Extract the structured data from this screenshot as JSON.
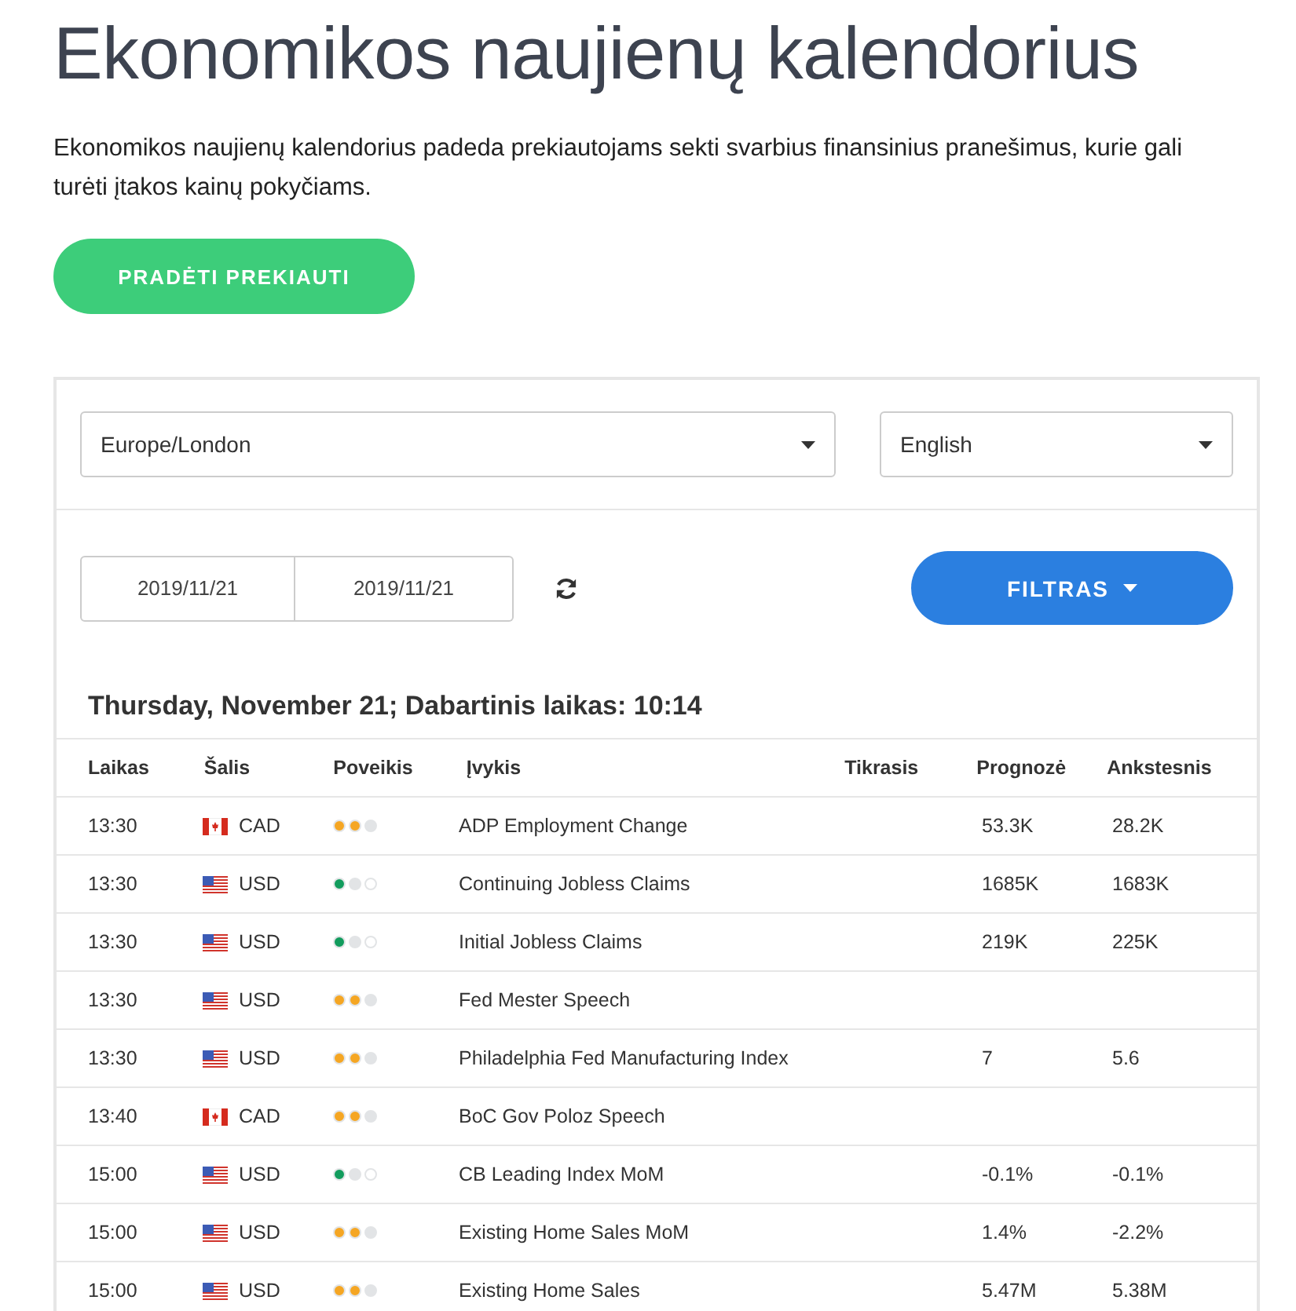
{
  "title": "Ekonomikos naujienų kalendorius",
  "intro": "Ekonomikos naujienų kalendorius padeda prekiautojams sekti svarbius finansinius pranešimus, kurie gali turėti įtakos kainų pokyčiams.",
  "cta": "PRADĖTI PREKIAUTI",
  "timezone": "Europe/London",
  "language": "English",
  "date_from": "2019/11/21",
  "date_to": "2019/11/21",
  "filter": "FILTRAS",
  "day_heading": "Thursday, November 21; Dabartinis laikas: 10:14",
  "columns": [
    "Laikas",
    "Šalis",
    "Poveikis",
    "Įvykis",
    "Tikrasis",
    "Prognozė",
    "Ankstesnis"
  ],
  "rows": [
    {
      "time": "13:30",
      "kind": "canada",
      "currency": "CAD",
      "level": 0.67,
      "event": "ADP Employment Change",
      "forecast": "53.3K",
      "previous": "28.2K"
    },
    {
      "time": "13:30",
      "kind": "usa",
      "currency": "USD",
      "level": 0.33,
      "event": "Continuing Jobless Claims",
      "forecast": "1685K",
      "previous": "1683K"
    },
    {
      "time": "13:30",
      "kind": "usa",
      "currency": "USD",
      "level": 0.33,
      "event": "Initial Jobless Claims",
      "forecast": "219K",
      "previous": "225K"
    },
    {
      "time": "13:30",
      "kind": "usa",
      "currency": "USD",
      "level": 0.67,
      "event": "Fed Mester Speech"
    },
    {
      "time": "13:30",
      "kind": "usa",
      "currency": "USD",
      "level": 0.67,
      "event": "Philadelphia Fed Manufacturing Index",
      "forecast": "7",
      "previous": "5.6"
    },
    {
      "time": "13:40",
      "kind": "canada",
      "currency": "CAD",
      "level": 0.67,
      "event": "BoC Gov Poloz Speech"
    },
    {
      "time": "15:00",
      "kind": "usa",
      "currency": "USD",
      "level": 0.33,
      "event": "CB Leading Index MoM",
      "forecast": "-0.1%",
      "previous": "-0.1%"
    },
    {
      "time": "15:00",
      "kind": "usa",
      "currency": "USD",
      "level": 0.67,
      "event": "Existing Home Sales MoM",
      "forecast": "1.4%",
      "previous": "-2.2%"
    },
    {
      "time": "15:00",
      "kind": "usa",
      "currency": "USD",
      "level": 0.67,
      "event": "Existing Home Sales",
      "forecast": "5.47M",
      "previous": "5.38M"
    }
  ]
}
